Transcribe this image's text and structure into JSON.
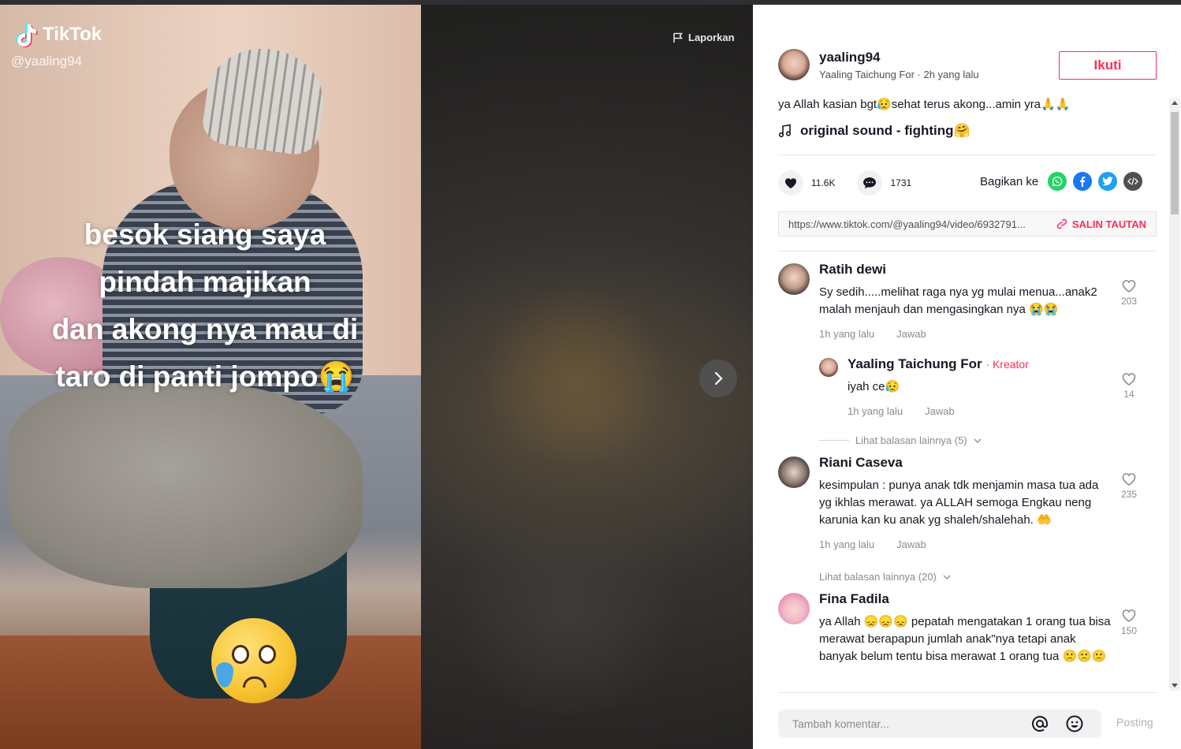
{
  "video": {
    "logo_text": "TikTok",
    "handle": "@yaaling94",
    "overlay_lines": [
      "besok siang saya",
      "pindah majikan",
      "dan akong nya mau di",
      "taro di panti jompo😭"
    ],
    "report_label": "Laporkan"
  },
  "author": {
    "username": "yaaling94",
    "subtitle": "Yaaling Taichung For · 2h yang lalu",
    "follow_label": "Ikuti"
  },
  "post": {
    "caption": "ya Allah kasian bgt😥sehat terus akong...amin yra🙏🙏",
    "music": "original sound - fighting🤗",
    "likes": "11.6K",
    "comments": "1731",
    "share_label": "Bagikan ke",
    "link": "https://www.tiktok.com/@yaaling94/video/6932791...",
    "copy_label": "SALIN TAUTAN"
  },
  "comments": [
    {
      "name": "Ratih dewi",
      "text": "Sy sedih.....melihat raga nya yg mulai menua...anak2 malah menjauh dan mengasingkan nya 😭😭",
      "time": "1h yang lalu",
      "reply": "Jawab",
      "likes": "203"
    },
    {
      "name": "Yaaling Taichung For",
      "tag": "· Kreator",
      "text": "iyah ce😥",
      "time": "1h yang lalu",
      "reply": "Jawab",
      "likes": "14"
    },
    {
      "more": "Lihat balasan lainnya (5)"
    },
    {
      "name": "Riani Caseva",
      "text": "kesimpulan : punya anak tdk menjamin masa tua ada yg ikhlas merawat. ya ALLAH semoga Engkau neng karunia kan ku anak yg shaleh/shalehah. 🤲",
      "time": "1h yang lalu",
      "reply": "Jawab",
      "likes": "235"
    },
    {
      "more": "Lihat balasan lainnya (20)"
    },
    {
      "name": "Fina Fadila",
      "text": "ya Allah 😞😞😞 pepatah mengatakan 1 orang tua bisa merawat berapapun jumlah anak\"nya tetapi anak banyak belum tentu bisa merawat 1 orang tua 🙁🙁🙁",
      "likes": "150"
    }
  ],
  "input": {
    "placeholder": "Tambah komentar...",
    "post_label": "Posting"
  },
  "colors": {
    "accent": "#fe2c55",
    "whatsapp": "#25d366",
    "facebook": "#1877f2",
    "twitter": "#1da1f2",
    "embed": "#505050"
  }
}
